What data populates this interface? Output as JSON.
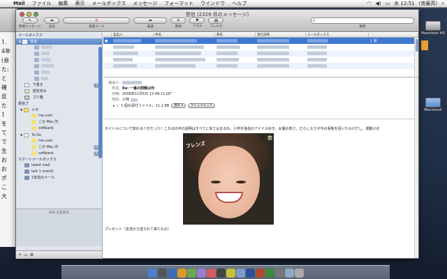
{
  "menubar": {
    "app": "Mail",
    "items": [
      "ファイル",
      "編集",
      "表示",
      "メールボックス",
      "メッセージ",
      "フォーマット",
      "ウインドウ",
      "ヘルプ"
    ],
    "clock": "水 12:51",
    "user_search": "(売最高)"
  },
  "bg_document": {
    "lines": [
      "1.",
      "4年",
      "(会",
      "た:",
      "と",
      "確",
      "反",
      "た",
      "1",
      "を",
      "て",
      "で",
      "生",
      "お",
      "お",
      "ポ",
      "こ",
      "大"
    ]
  },
  "desktop": {
    "icons": [
      "Macintosh HD",
      "Macintosh"
    ]
  },
  "window": {
    "title": "受信 (2329 件のメッセージ)",
    "toolbar": [
      {
        "label": "新規メッセージ",
        "glyph": "✎"
      },
      {
        "label": "返信",
        "glyph": "⬅"
      },
      {
        "label": "迷惑メール",
        "glyph": "⊘"
      },
      {
        "label": "転送",
        "glyph": "➡"
      },
      {
        "label": "削除",
        "glyph": "✕"
      },
      {
        "label": "フラグ",
        "glyph": "⚑"
      },
      {
        "label": "フィルタ",
        "glyph": "▤"
      }
    ],
    "search_label": "検索",
    "search_placeholder": ""
  },
  "sidebar": {
    "section1": "メールボックス",
    "inbox": "受信",
    "drafts": "下書き",
    "drafts_badge": "1",
    "sent": "送信済み",
    "trash": "ゴミ箱",
    "section2": "受信ブ",
    "notes_group": "メモ",
    "notes_items": [
      "me.com",
      "この Mac 内",
      "softbank"
    ],
    "todo_group": "To Do",
    "todo_items": [
      "me.com",
      "この Mac 内",
      "softbank"
    ],
    "todo_badges": [
      "2",
      "1"
    ],
    "section3": "スマートメールボックス",
    "smart_items": [
      "latest mail",
      "last 1 month",
      "1年前のメール"
    ],
    "activity_title": "Mail 応答状況"
  },
  "list": {
    "columns": [
      "差出人",
      "件名",
      "宛先",
      "受信日時",
      "メールボックス"
    ],
    "selected_flag": "1 受"
  },
  "preview": {
    "from_label": "差出人:",
    "subject_label": "件名:",
    "subject": "Re: 一番の問題は何",
    "date_label": "日時:",
    "date": "2008年11月5日 12:49:11 JST",
    "to_label": "宛先:",
    "to": "小林",
    "attachment": "1 個の添付ファイル、11.2 KB",
    "save_button": "保存 ▾",
    "quicklook_button": "クイックルック",
    "body": "タイトルについて知れるべきだった！これほの中の説明はすべてにあてはまるね。小学を独自のアイドル好き、女優の意さ、だらしなさが今の事態を招いたわけだし。運動けの",
    "photo_logo": "フレンズ",
    "photo_logo2": "奈",
    "caption": "プレゼント（友達から送られて来たもの）"
  },
  "colors": {
    "selection": "#3f78d4",
    "sidebar_bg": "#e1e6ee",
    "accent": "#5a86c4"
  }
}
